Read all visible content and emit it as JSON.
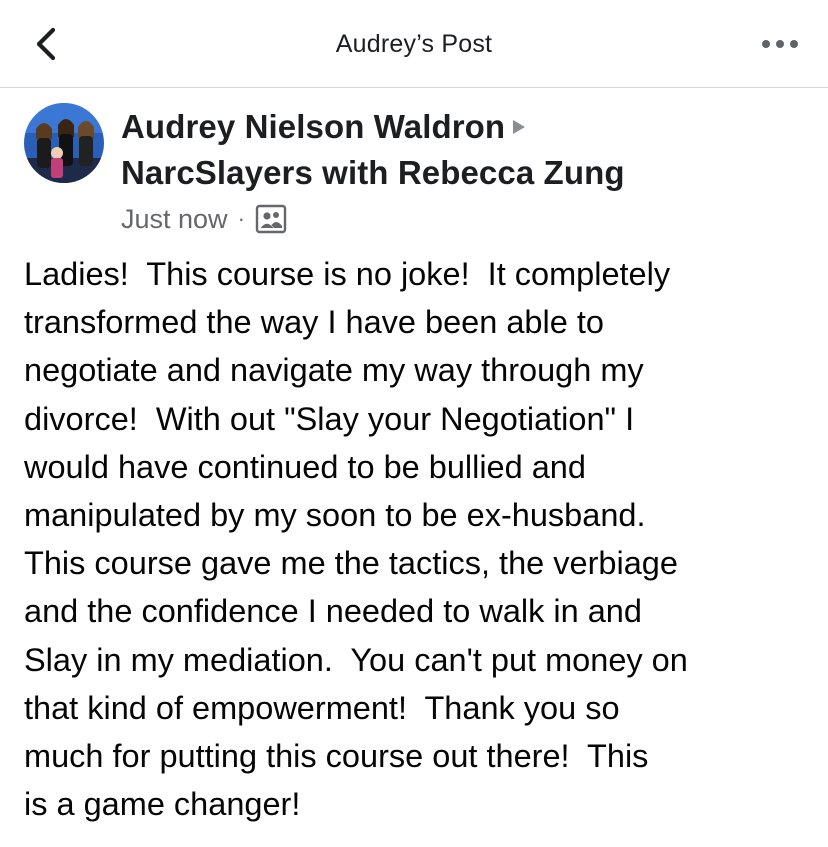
{
  "nav": {
    "title": "Audrey’s Post",
    "back_icon": "chevron-left-icon",
    "more_icon": "more-horizontal-icon"
  },
  "post": {
    "author": "Audrey Nielson Waldron",
    "group": "NarcSlayers with Rebecca Zung",
    "timestamp": "Just now",
    "separator": "·",
    "audience_icon": "group-members-icon",
    "body_lines": [
      "Ladies!  This course is no joke!  It completely",
      "transformed the way I have been able to",
      "negotiate and navigate my way through my",
      "divorce!  With out \"Slay your Negotiation\" I",
      "would have continued to be bullied and",
      "manipulated by my soon to be ex-husband.",
      "This course gave me the tactics, the verbiage",
      "and the confidence I needed to walk in and",
      "Slay in my mediation.  You can't put money on",
      "that kind of empowerment!  Thank you so",
      "much for putting this course out there!  This",
      "is a game changer!"
    ]
  },
  "colors": {
    "text_primary": "#1c1e21",
    "text_secondary": "#65676b",
    "divider": "#d8d8d8",
    "avatar_bg": "#2a5fb8"
  }
}
